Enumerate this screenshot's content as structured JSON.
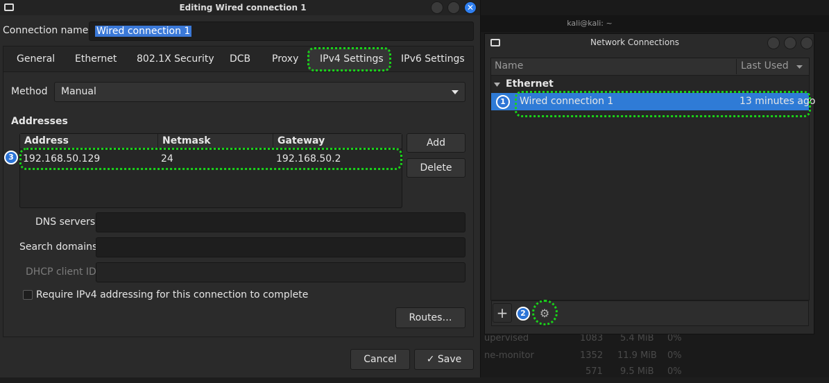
{
  "background": {
    "terminal_title": "kali@kali: ~",
    "processes": [
      {
        "name": "upervised",
        "pid": "1083",
        "mem": "5.4 MiB",
        "cpu": "0%"
      },
      {
        "name": "ne-monitor",
        "pid": "1352",
        "mem": "11.9 MiB",
        "cpu": "0%"
      },
      {
        "name": "",
        "pid": "571",
        "mem": "9.5 MiB",
        "cpu": "0%"
      }
    ]
  },
  "edit_dialog": {
    "title": "Editing Wired connection 1",
    "connection_name_label": "Connection name",
    "connection_name_value": "Wired connection 1",
    "tabs": [
      "General",
      "Ethernet",
      "802.1X Security",
      "DCB",
      "Proxy",
      "IPv4 Settings",
      "IPv6 Settings"
    ],
    "active_tab": "IPv4 Settings",
    "method_label": "Method",
    "method_value": "Manual",
    "addresses_label": "Addresses",
    "columns": [
      "Address",
      "Netmask",
      "Gateway"
    ],
    "rows": [
      {
        "address": "192.168.50.129",
        "netmask": "24",
        "gateway": "192.168.50.2"
      }
    ],
    "add_label": "Add",
    "delete_label": "Delete",
    "dns_label": "DNS servers",
    "dns_value": "",
    "search_label": "Search domains",
    "search_value": "",
    "dhcp_label": "DHCP client ID",
    "dhcp_value": "",
    "require_label": "Require IPv4 addressing for this connection to complete",
    "routes_label": "Routes…",
    "cancel_label": "Cancel",
    "save_label": "Save"
  },
  "network_connections": {
    "title": "Network Connections",
    "col_name": "Name",
    "col_last_used": "Last Used",
    "group": "Ethernet",
    "items": [
      {
        "name": "Wired connection 1",
        "last_used": "13 minutes ago"
      }
    ]
  },
  "badges": [
    "1",
    "2",
    "3"
  ],
  "colors": {
    "highlight": "#19d419",
    "selection": "#2f7bd6",
    "badge": "#2c74d6"
  }
}
